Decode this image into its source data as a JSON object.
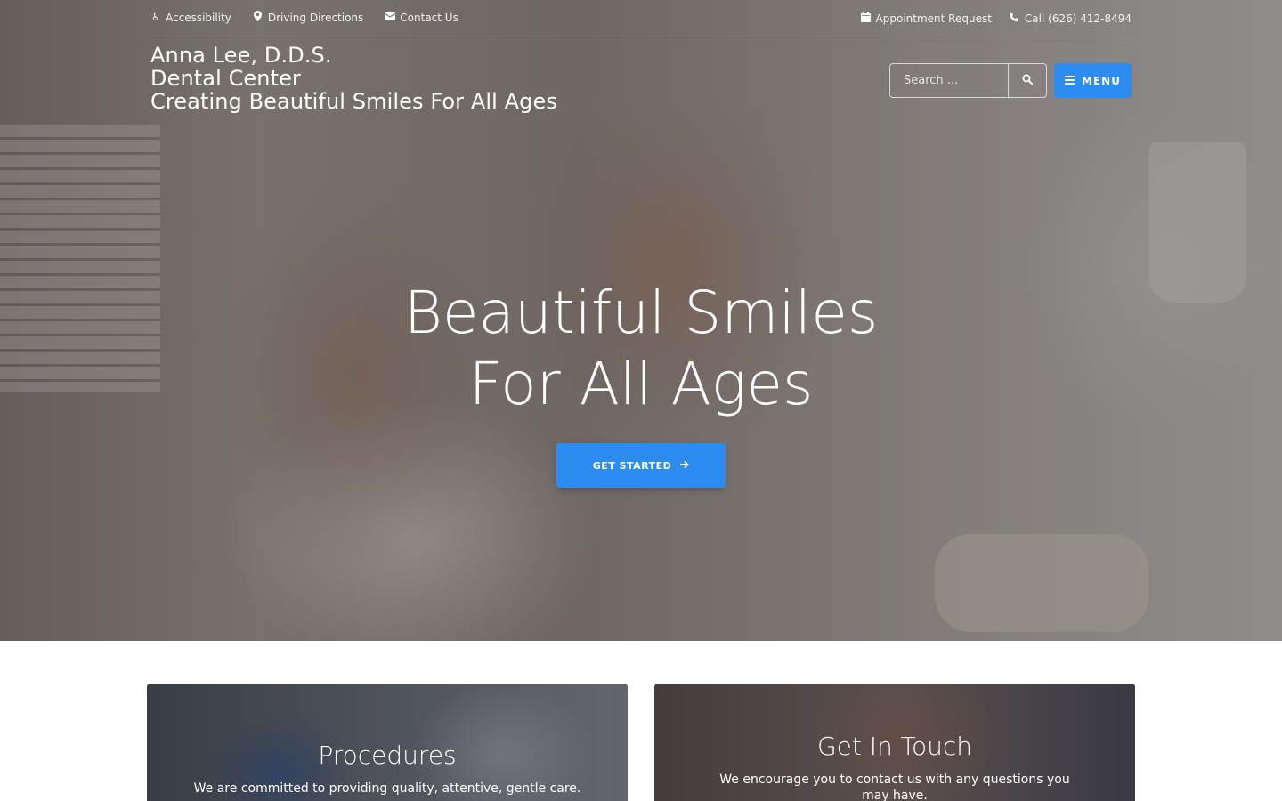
{
  "topbar": {
    "left_links": [
      {
        "label": "Accessibility",
        "icon": "wheelchair-icon"
      },
      {
        "label": "Driving Directions",
        "icon": "map-marker-icon"
      },
      {
        "label": "Contact Us",
        "icon": "envelope-icon"
      }
    ],
    "right_links": [
      {
        "label": "Appointment Request",
        "icon": "calendar-icon"
      },
      {
        "label": "Call (626) 412-8494",
        "icon": "phone-icon"
      }
    ]
  },
  "brand": {
    "line1": "Anna Lee, D.D.S.",
    "line2": "Dental Center",
    "line3": "Creating Beautiful Smiles For All Ages"
  },
  "search": {
    "placeholder": "Search ...",
    "icon": "search-icon"
  },
  "menu": {
    "label": "MENU",
    "icon": "hamburger-icon"
  },
  "hero": {
    "title_line1": "Beautiful Smiles",
    "title_line2": "For All Ages",
    "cta_label": "GET STARTED",
    "cta_icon": "arrow-right-icon"
  },
  "cards": [
    {
      "title": "Procedures",
      "text": "We are committed to providing quality, attentive, gentle care."
    },
    {
      "title": "Get In Touch",
      "text": "We encourage you to contact us with any questions you may have."
    }
  ],
  "colors": {
    "accent": "#2d8cf0"
  }
}
